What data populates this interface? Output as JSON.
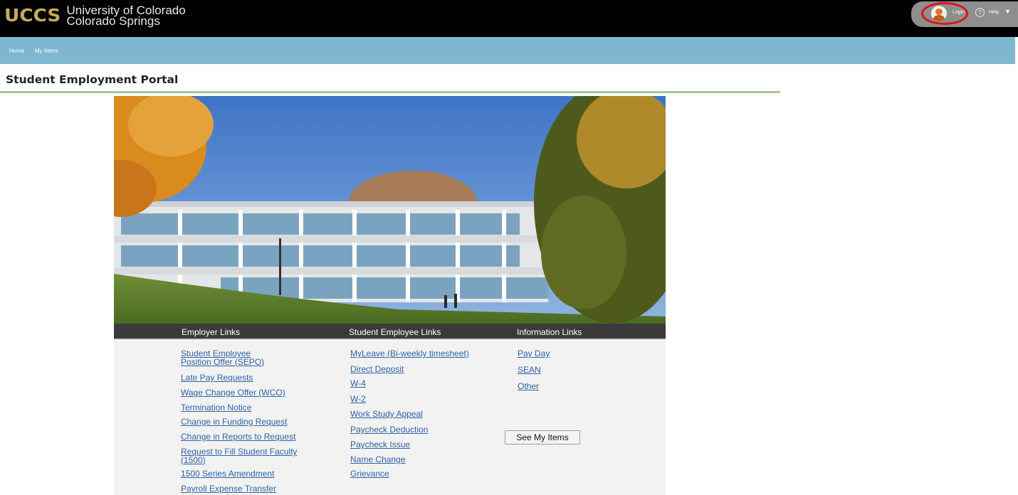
{
  "header": {
    "logo_mark": "UCCS",
    "logo_line1": "University of Colorado",
    "logo_line2": "Colorado Springs",
    "login_label": "Login",
    "help_label": "Help"
  },
  "nav": {
    "items": [
      {
        "label": "Home"
      },
      {
        "label": "My Items"
      }
    ]
  },
  "page": {
    "title": "Student Employment Portal"
  },
  "links": {
    "headers": [
      "Employer Links",
      "Student Employee Links",
      "Information Links"
    ],
    "employer": [
      {
        "line1": "Student Employee ",
        "line2": "Position Offer (SEPO)"
      },
      {
        "line1": "Late Pay Requests"
      },
      {
        "line1": "Wage Change Offer (WCO)"
      },
      {
        "line1": "Termination Notice"
      },
      {
        "line1": "Change in Funding Request"
      },
      {
        "line1": "Change in Reports to Request"
      },
      {
        "line1": "Request to Fill Student Faculty ",
        "line2": "(1500)"
      },
      {
        "line1": "1500 Series Amendment"
      },
      {
        "line1": "Payroll Expense Transfer "
      }
    ],
    "student": [
      {
        "line1": "MyLeave (Bi-weekly timesheet)"
      },
      {
        "line1": "Direct Deposit"
      },
      {
        "line1": "W-4"
      },
      {
        "line1": "W-2"
      },
      {
        "line1": "Work Study Appeal"
      },
      {
        "line1": "Paycheck Deduction"
      },
      {
        "line1": "Paycheck Issue"
      },
      {
        "line1": "Name Change"
      },
      {
        "line1": "Grievance"
      }
    ],
    "information": [
      {
        "line1": "Pay Day"
      },
      {
        "line1": "SEAN"
      },
      {
        "line1": "Other"
      }
    ],
    "see_items_button": "See My Items"
  },
  "colors": {
    "topbar": "#000000",
    "navbar": "#7fb7d0",
    "link": "#2f63a6",
    "title_rule": "#a5c39d",
    "annotation_ring": "#e01313"
  }
}
